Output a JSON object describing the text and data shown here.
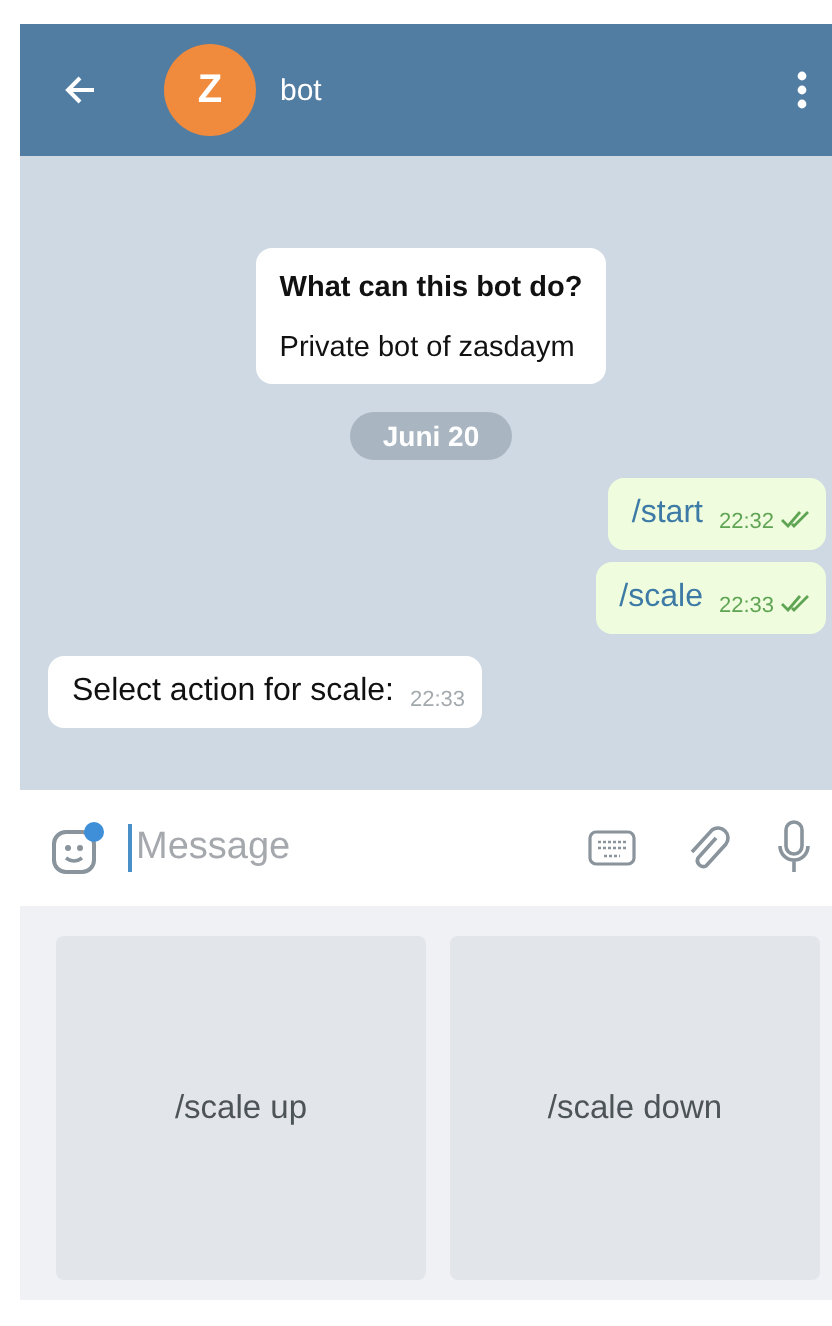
{
  "header": {
    "avatar_letter": "Z",
    "title": "bot"
  },
  "messages": [
    {
      "kind": "intro",
      "title": "What can this bot do?",
      "text": "Private bot of zasdaym"
    },
    {
      "kind": "date",
      "text": "Juni 20"
    },
    {
      "kind": "out",
      "text": "/start",
      "time": "22:32",
      "read": true
    },
    {
      "kind": "out",
      "text": "/scale",
      "time": "22:33",
      "read": true
    },
    {
      "kind": "in",
      "text": "Select action for scale:",
      "time": "22:33"
    }
  ],
  "input": {
    "placeholder": "Message"
  },
  "keyboard": {
    "buttons": [
      "/scale up",
      "/scale down"
    ]
  }
}
